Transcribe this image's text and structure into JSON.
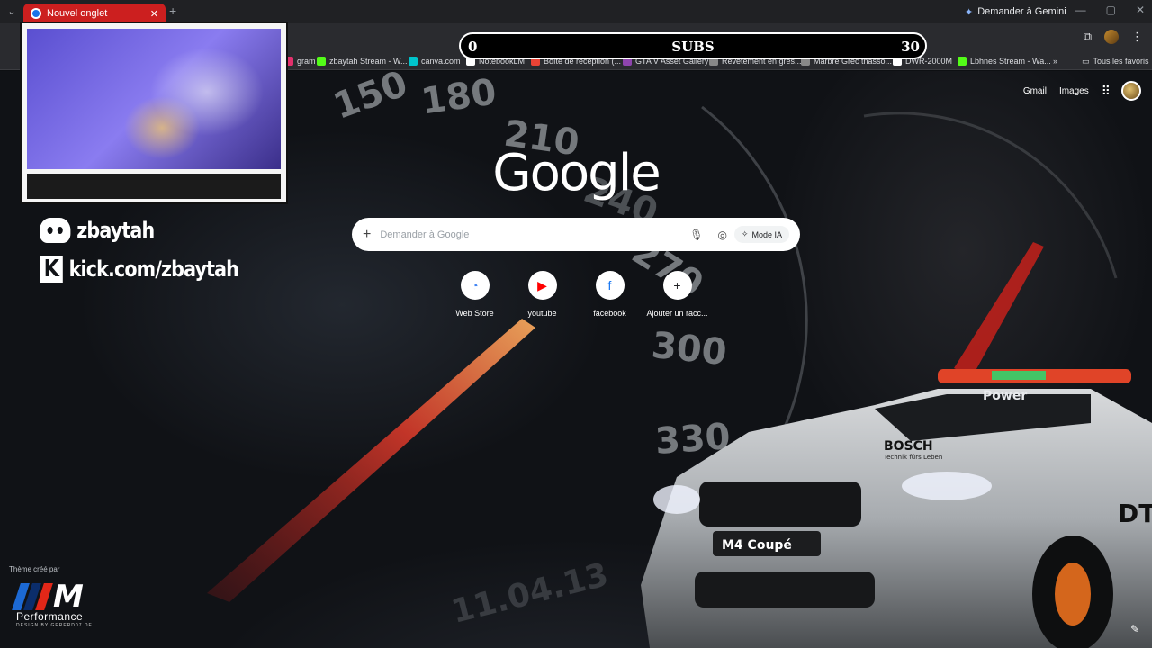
{
  "browser": {
    "tab_title": "Nouvel onglet",
    "new_tab_glyph": "+",
    "gemini_label": "Demander à Gemini",
    "bookmarks": [
      {
        "label": "gram",
        "color": "#e1306c"
      },
      {
        "label": "zbaytah Stream - W...",
        "color": "#53fc18"
      },
      {
        "label": "canva.com",
        "color": "#00c4cc"
      },
      {
        "label": "NotebookLM",
        "color": "#ffffff"
      },
      {
        "label": "Boîte de réception (...",
        "color": "#ea4335"
      },
      {
        "label": "GTA V Asset Gallery",
        "color": "#8e44ad"
      },
      {
        "label": "Revêtement en grès...",
        "color": "#888888"
      },
      {
        "label": "Marbre Grec thasso...",
        "color": "#888888"
      },
      {
        "label": "DWR-2000M",
        "color": "#ffffff"
      },
      {
        "label": "Lbhnes Stream - Wa...",
        "color": "#53fc18"
      }
    ],
    "all_bookmarks_label": "Tous les favoris"
  },
  "overlay": {
    "subs_min": "0",
    "subs_label": "SUBS",
    "subs_max": "30",
    "discord": "zbaytah",
    "kick": "kick.com/zbaytah"
  },
  "ntp": {
    "gmail": "Gmail",
    "images": "Images",
    "logo": "Google",
    "search_placeholder": "Demander à Google",
    "ai_mode": "Mode IA",
    "shortcuts": [
      {
        "label": "Web Store",
        "icon": "webstore-icon",
        "glyph": "◔",
        "color": "#4285f4"
      },
      {
        "label": "youtube",
        "icon": "youtube-icon",
        "glyph": "▶",
        "color": "#ff0000"
      },
      {
        "label": "facebook",
        "icon": "facebook-icon",
        "glyph": "f",
        "color": "#1877f2"
      },
      {
        "label": "Ajouter un racc...",
        "icon": "plus-icon",
        "glyph": "+",
        "color": "#202124"
      }
    ],
    "theme_credit": "Thème créé par",
    "theme_brand": "Performance",
    "theme_brand_sub": "DESIGN BY GERERD07.DE"
  },
  "wallpaper": {
    "gauge_numbers": [
      "150",
      "180",
      "210",
      "240",
      "270",
      "300",
      "330",
      "11.04.13"
    ],
    "car_badge": "M4 Coupé",
    "car_banner": "Power",
    "car_sponsor": "BOSCH",
    "car_sponsor_sub": "Technik fürs Leben",
    "car_door": "DTM"
  }
}
